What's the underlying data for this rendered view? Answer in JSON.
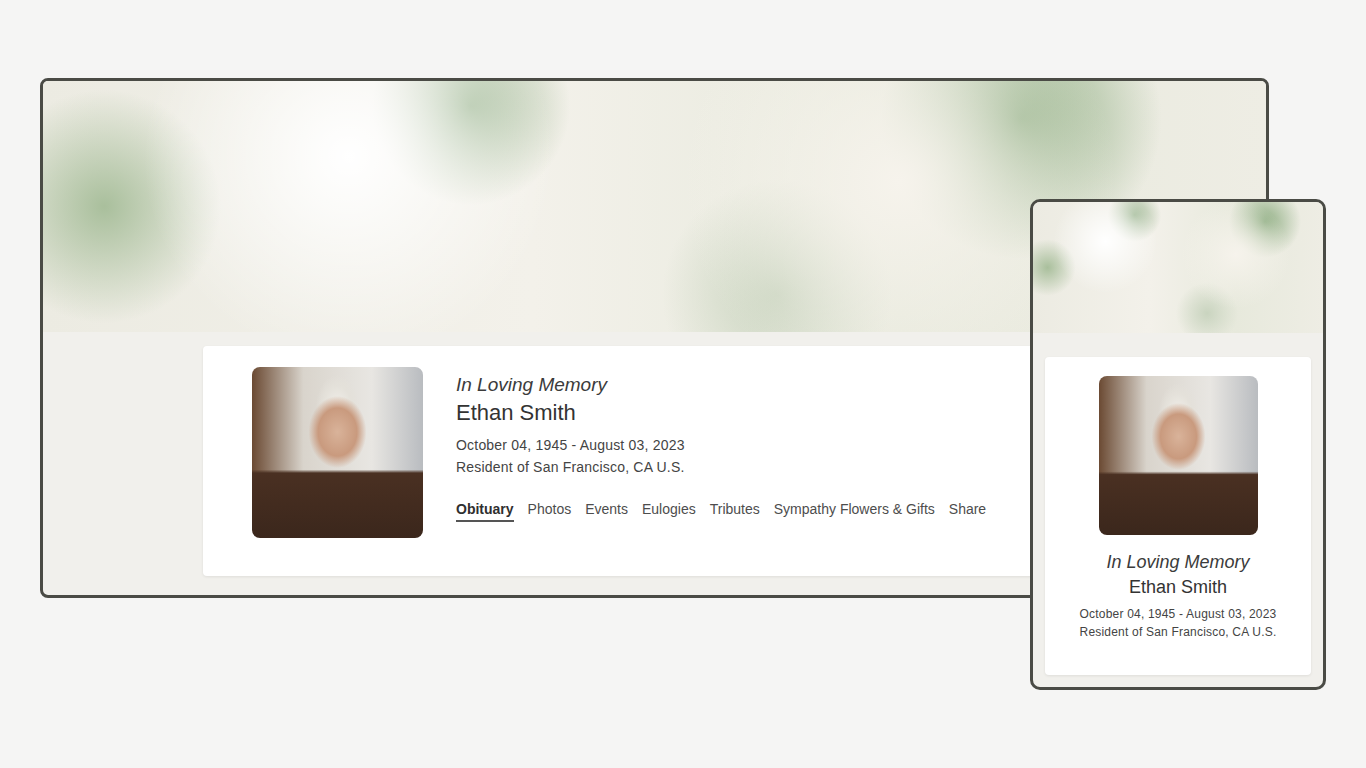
{
  "desktop": {
    "memorial": {
      "heading": "In Loving Memory",
      "name": "Ethan Smith",
      "dates": "October 04, 1945 - August 03, 2023",
      "residence": "Resident of San Francisco, CA U.S."
    },
    "tabs": [
      {
        "label": "Obituary",
        "selected": true
      },
      {
        "label": "Photos",
        "selected": false
      },
      {
        "label": "Events",
        "selected": false
      },
      {
        "label": "Eulogies",
        "selected": false
      },
      {
        "label": "Tributes",
        "selected": false
      },
      {
        "label": "Sympathy Flowers & Gifts",
        "selected": false
      },
      {
        "label": "Share",
        "selected": false
      }
    ]
  },
  "mobile": {
    "memorial": {
      "heading": "In Loving Memory",
      "name": "Ethan Smith",
      "dates": "October 04, 1945 - August 03, 2023",
      "residence": "Resident of San Francisco, CA U.S."
    }
  }
}
